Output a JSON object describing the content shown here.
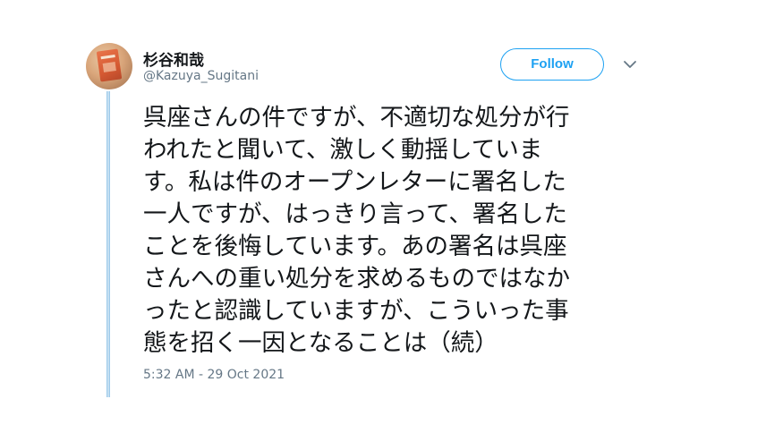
{
  "author": {
    "display_name": "杉谷和哉",
    "handle": "@Kazuya_Sugitani"
  },
  "actions": {
    "follow_label": "Follow"
  },
  "tweet": {
    "lines": [
      "呉座さんの件ですが、不適切な処分が行",
      "われたと聞いて、激しく動揺していま",
      "す。私は件のオープンレターに署名した",
      "一人ですが、はっきり言って、署名した",
      "ことを後悔しています。あの署名は呉座",
      "さんへの重い処分を求めるものではなか",
      "ったと認識していますが、こういった事",
      "態を招く一因となることは（続）"
    ],
    "timestamp": "5:32 AM - 29 Oct 2021"
  },
  "icons": {
    "avatar": "avatar-photo",
    "menu": "chevron-down-icon"
  },
  "colors": {
    "accent": "#1da1f2",
    "thread_line": "#c4dff2",
    "secondary_text": "#657786",
    "primary_text": "#14171a"
  }
}
